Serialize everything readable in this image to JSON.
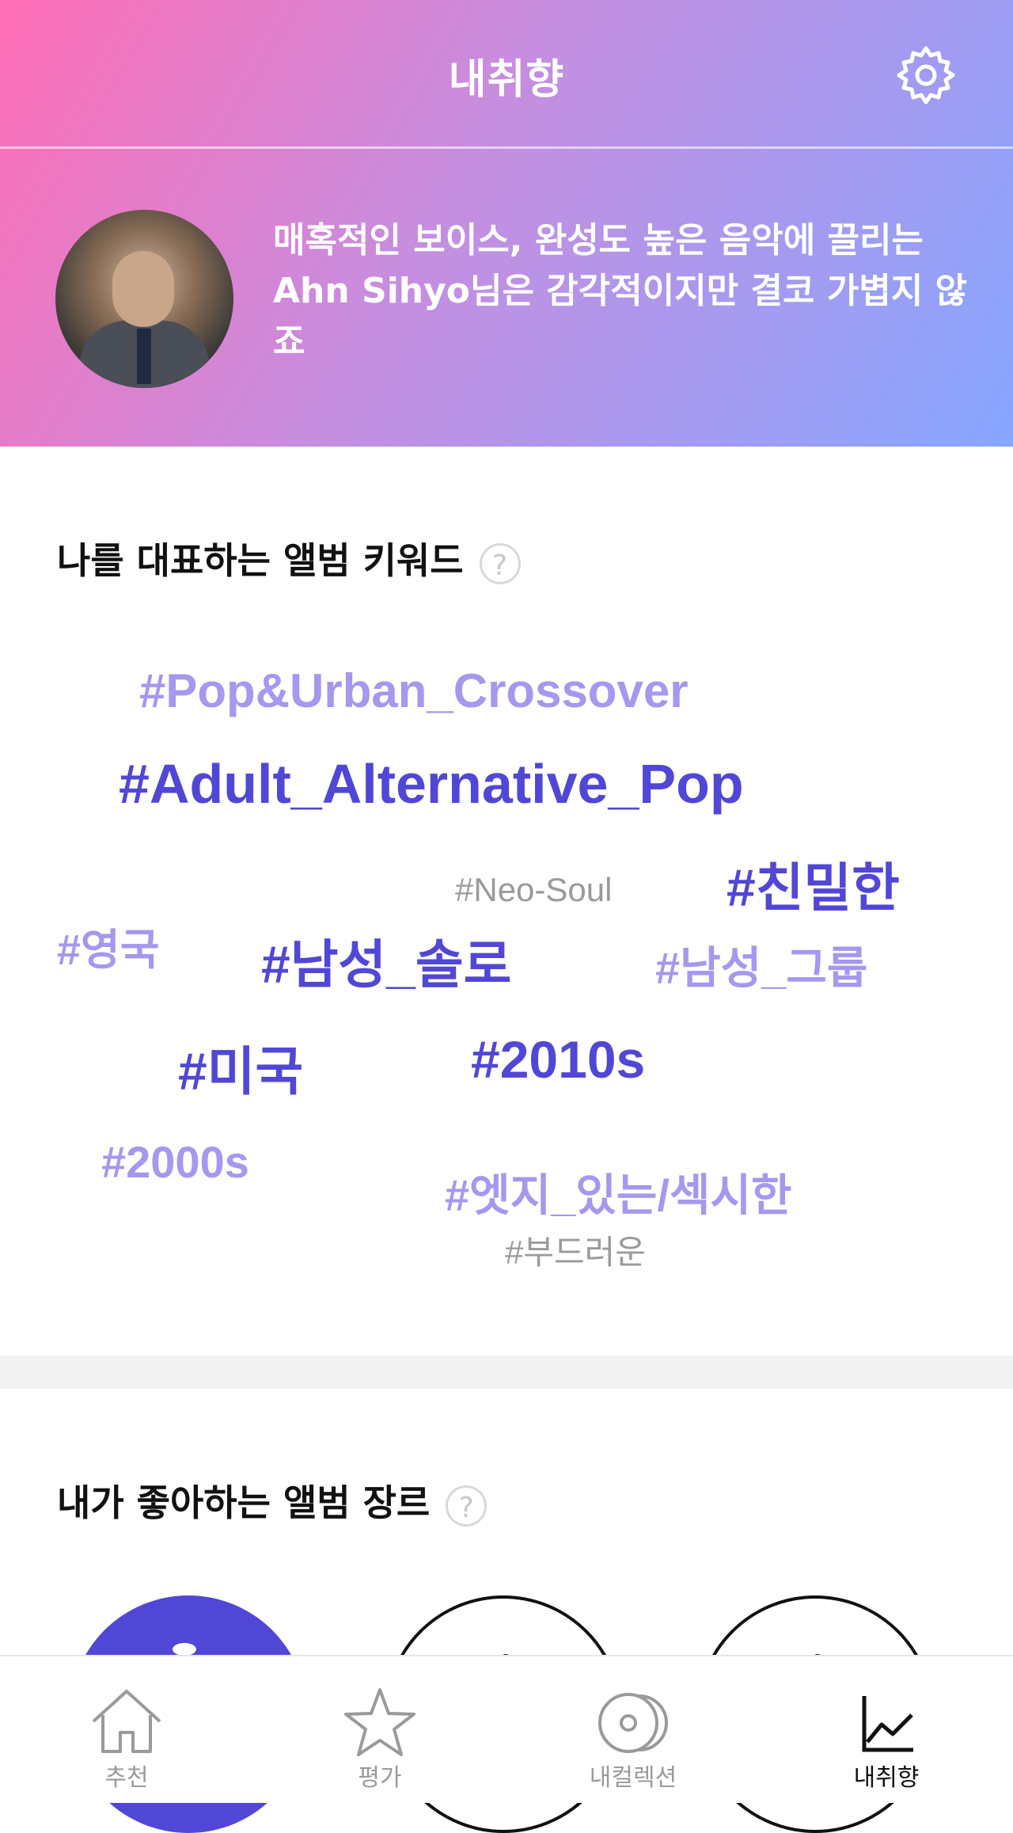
{
  "header": {
    "title": "내취향"
  },
  "profile": {
    "tagline": "매혹적인 보이스, 완성도 높은 음악에 끌리는 Ahn Sihyo님은 감각적이지만 결코 가볍지 않죠"
  },
  "keywords_section": {
    "title": "나를 대표하는 앨범 키워드",
    "help": "?",
    "keywords": [
      "#Pop&Urban_Crossover",
      "#Adult_Alternative_Pop",
      "#친밀한",
      "#Neo-Soul",
      "#영국",
      "#남성_솔로",
      "#남성_그룹",
      "#미국",
      "#2010s",
      "#2000s",
      "#엣지_있는/섹시한",
      "#부드러운"
    ]
  },
  "genre_section": {
    "title": "내가 좋아하는 앨범 장르",
    "help": "?"
  },
  "tabs": [
    {
      "label": "추천",
      "icon": "home-icon"
    },
    {
      "label": "평가",
      "icon": "star-icon"
    },
    {
      "label": "내컬렉션",
      "icon": "disc-icon"
    },
    {
      "label": "내취향",
      "icon": "chart-icon"
    }
  ],
  "colors": {
    "accent": "#5147d6",
    "accent_light": "#a498ef",
    "gradient_start": "#ff6db5",
    "gradient_end": "#86a6ff"
  }
}
